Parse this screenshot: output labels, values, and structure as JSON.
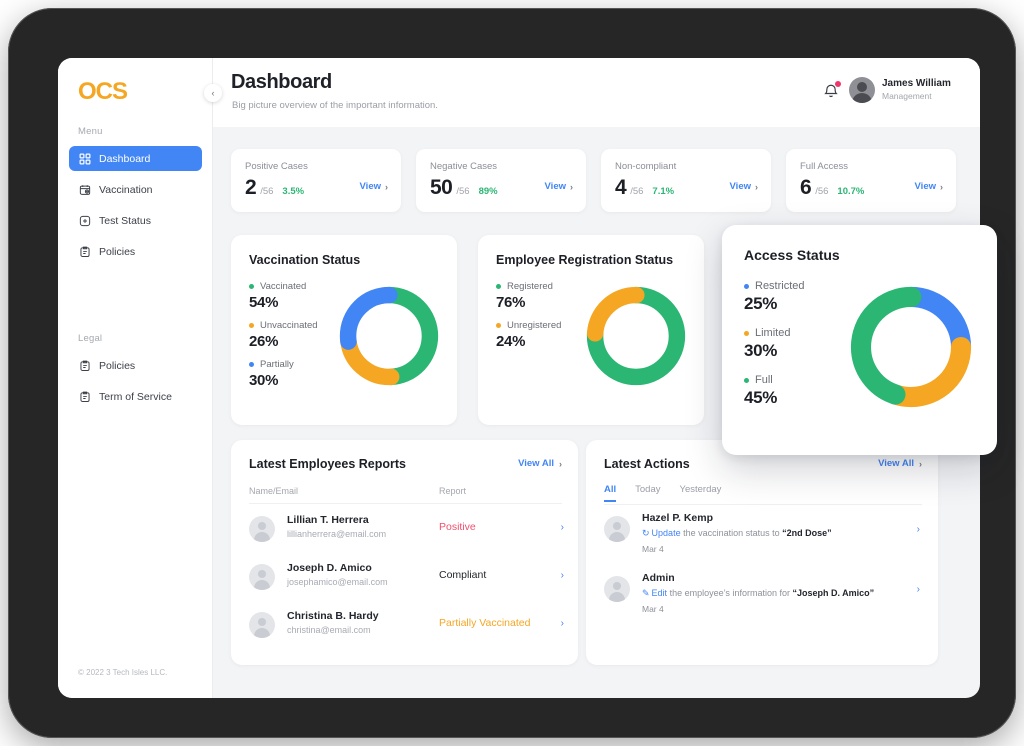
{
  "brand": {
    "logo_text": "OCS",
    "logo_color": "#F5A623"
  },
  "sidebar": {
    "menu_label": "Menu",
    "legal_label": "Legal",
    "menu_items": [
      {
        "label": "Dashboard",
        "icon": "grid-icon",
        "active": true
      },
      {
        "label": "Vaccination",
        "icon": "vaccine-icon",
        "active": false
      },
      {
        "label": "Test Status",
        "icon": "test-icon",
        "active": false
      },
      {
        "label": "Policies",
        "icon": "clipboard-icon",
        "active": false
      }
    ],
    "legal_items": [
      {
        "label": "Policies",
        "icon": "clipboard-icon",
        "active": false
      },
      {
        "label": "Term of Service",
        "icon": "clipboard-icon",
        "active": false
      }
    ],
    "footer": "© 2022 3 Tech Isles LLC.",
    "collapse_icon": "chevron-left-icon"
  },
  "header": {
    "title": "Dashboard",
    "subtitle": "Big picture overview of the important information.",
    "bell_icon": "bell-icon",
    "user": {
      "name": "James William",
      "role": "Management"
    }
  },
  "stats": [
    {
      "title": "Positive Cases",
      "value": "2",
      "total": "/56",
      "pct": "3.5%",
      "view": "View"
    },
    {
      "title": "Negative Cases",
      "value": "50",
      "total": "/56",
      "pct": "89%",
      "view": "View"
    },
    {
      "title": "Non-compliant",
      "value": "4",
      "total": "/56",
      "pct": "7.1%",
      "view": "View"
    },
    {
      "title": "Full Access",
      "value": "6",
      "total": "/56",
      "pct": "10.7%",
      "view": "View"
    }
  ],
  "chart_data": [
    {
      "type": "pie",
      "title": "Vaccination Status",
      "categories": [
        "Vaccinated",
        "Unvaccinated",
        "Partially"
      ],
      "values": [
        54,
        26,
        30
      ],
      "value_labels": [
        "54%",
        "26%",
        "30%"
      ],
      "colors": [
        "#2BB673",
        "#F5A623",
        "#4285F4"
      ],
      "legend": "left",
      "donut": true
    },
    {
      "type": "pie",
      "title": "Employee Registration Status",
      "categories": [
        "Registered",
        "Unregistered"
      ],
      "values": [
        76,
        24
      ],
      "value_labels": [
        "76%",
        "24%"
      ],
      "colors": [
        "#2BB673",
        "#F5A623"
      ],
      "legend": "left",
      "donut": true
    },
    {
      "type": "pie",
      "title": "Access Status",
      "categories": [
        "Restricted",
        "Limited",
        "Full"
      ],
      "values": [
        25,
        30,
        45
      ],
      "value_labels": [
        "25%",
        "30%",
        "45%"
      ],
      "colors": [
        "#4285F4",
        "#F5A623",
        "#2BB673"
      ],
      "legend": "left",
      "donut": true
    }
  ],
  "reports_panel": {
    "title": "Latest Employees Reports",
    "view_all": "View All",
    "columns": [
      "Name/Email",
      "Report"
    ],
    "rows": [
      {
        "name": "Lillian T. Herrera",
        "email": "lillianherrera@email.com",
        "report": "Positive",
        "report_color": "#F0506E"
      },
      {
        "name": "Joseph D. Amico",
        "email": "josephamico@email.com",
        "report": "Compliant",
        "report_color": "#24262d"
      },
      {
        "name": "Christina B. Hardy",
        "email": "christina@email.com",
        "report": "Partially Vaccinated",
        "report_color": "#F5A623"
      }
    ]
  },
  "actions_panel": {
    "title": "Latest Actions",
    "view_all": "View All",
    "tabs": [
      {
        "label": "All",
        "active": true
      },
      {
        "label": "Today",
        "active": false
      },
      {
        "label": "Yesterday",
        "active": false
      }
    ],
    "rows": [
      {
        "name": "Hazel P. Kemp",
        "verb": "Update",
        "verb_icon": "refresh-icon",
        "middle": " the vaccination status to ",
        "target": "“2nd Dose”",
        "date": "Mar 4"
      },
      {
        "name": "Admin",
        "verb": "Edit",
        "verb_icon": "pencil-icon",
        "middle": " the employee’s information for ",
        "target": "“Joseph D. Amico”",
        "date": "Mar 4"
      }
    ]
  },
  "colors": {
    "accent": "#4285F4",
    "green": "#2BB673",
    "orange": "#F5A623",
    "red": "#F0506E",
    "bg": "#f3f4f6"
  }
}
